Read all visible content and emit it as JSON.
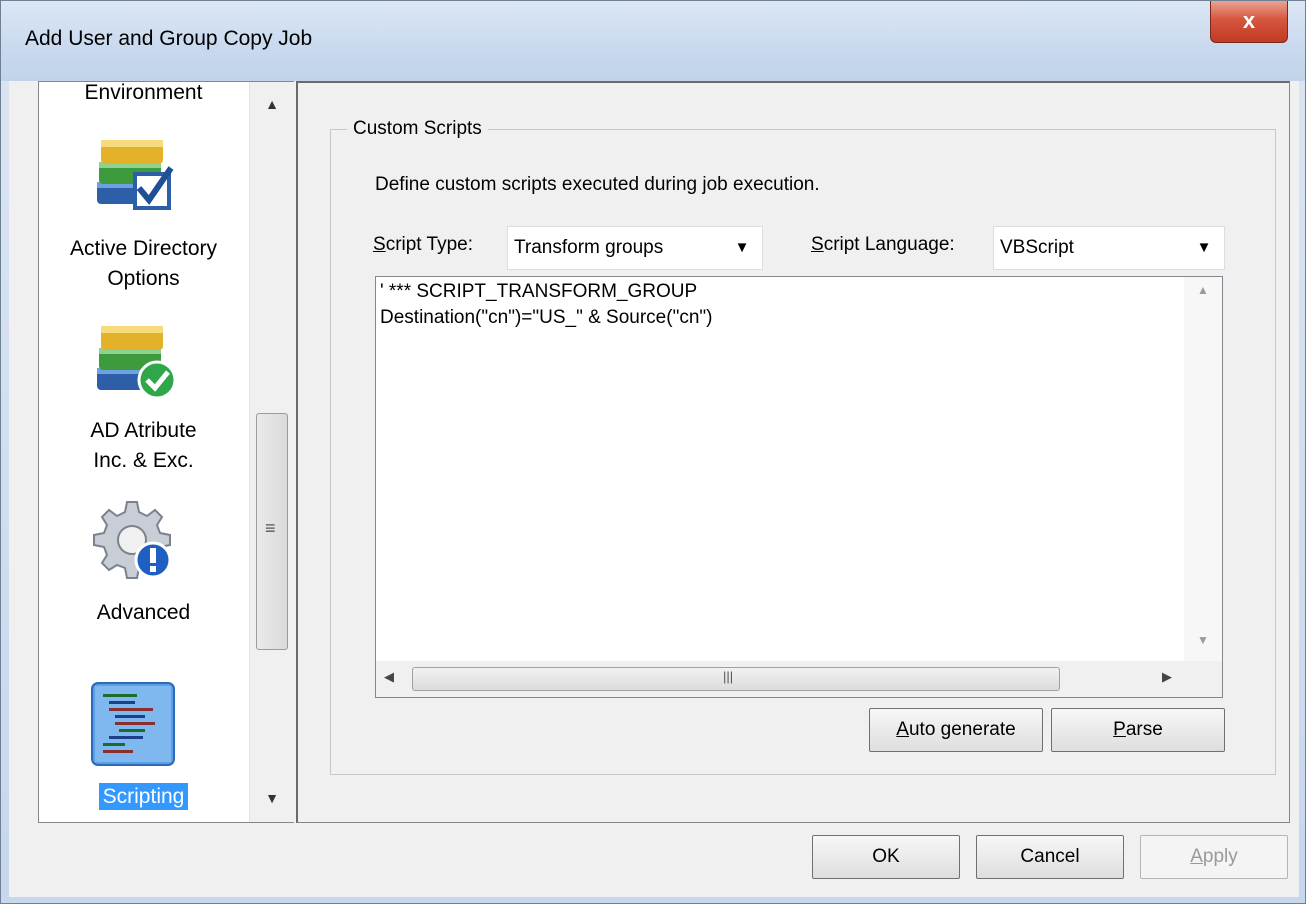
{
  "window": {
    "title": "Add User and Group Copy Job",
    "close_glyph": "x"
  },
  "nav": {
    "items": [
      {
        "label": "Environment",
        "icon": "environment-icon"
      },
      {
        "label": "Active Directory\nOptions",
        "icon": "books-checkbox-icon"
      },
      {
        "label": "AD Atribute\nInc. & Exc.",
        "icon": "books-checkmark-icon"
      },
      {
        "label": "Advanced",
        "icon": "gear-info-icon"
      },
      {
        "label": "Scripting",
        "icon": "scripting-icon",
        "selected": true
      }
    ]
  },
  "custom_scripts": {
    "legend": "Custom Scripts",
    "description": "Define custom scripts executed during job execution.",
    "script_type_label_u": "S",
    "script_type_label_rest": "cript Type:",
    "script_type_value": "Transform groups",
    "script_language_label_u": "S",
    "script_language_label_rest": "cript Language:",
    "script_language_value": "VBScript",
    "code_line1": "' *** SCRIPT_TRANSFORM_GROUP",
    "code_line2": "Destination(\"cn\")=\"US_\" & Source(\"cn\")",
    "auto_generate_u": "A",
    "auto_generate_rest": "uto generate",
    "parse_u": "P",
    "parse_rest": "arse"
  },
  "footer": {
    "ok": "OK",
    "cancel": "Cancel",
    "apply_u": "A",
    "apply_rest": "pply"
  },
  "colors": {
    "selection": "#3399ff",
    "close": "#c13a24"
  }
}
